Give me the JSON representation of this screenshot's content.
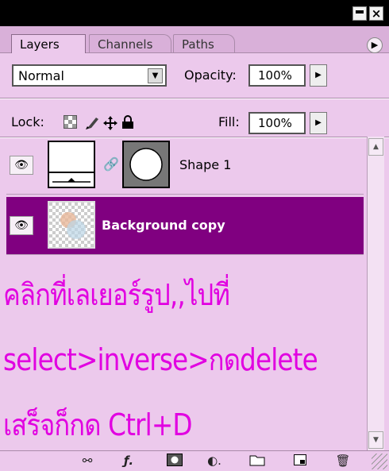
{
  "tabs": [
    "Layers",
    "Channels",
    "Paths"
  ],
  "blend_mode": "Normal",
  "opacity_label": "Opacity:",
  "opacity_value": "100%",
  "lock_label": "Lock:",
  "fill_label": "Fill:",
  "fill_value": "100%",
  "layers": [
    {
      "name": "Shape 1",
      "selected": false
    },
    {
      "name": "Background copy",
      "selected": true
    }
  ],
  "annotation": {
    "line1": "คลิกที่เลเยอร์รูป,,ไปที่",
    "line2": "select>inverse>กดdelete",
    "line3": "เสร็จก็กด  Ctrl+D"
  },
  "icons": {
    "titlebar": [
      "minimize-icon",
      "close-icon"
    ],
    "panel_menu": "panel-menu-arrow-icon",
    "lock": [
      "lock-transparent-icon",
      "lock-image-icon",
      "lock-position-icon",
      "lock-all-icon"
    ],
    "bottom": [
      "link-layers-icon",
      "layer-style-icon",
      "layer-mask-icon",
      "adjustment-layer-icon",
      "new-group-icon",
      "new-layer-icon",
      "delete-layer-icon"
    ]
  },
  "colors": {
    "panel_bg": "#ecc9ec",
    "selected_row": "#800080",
    "annotation_text": "#e100e1"
  }
}
